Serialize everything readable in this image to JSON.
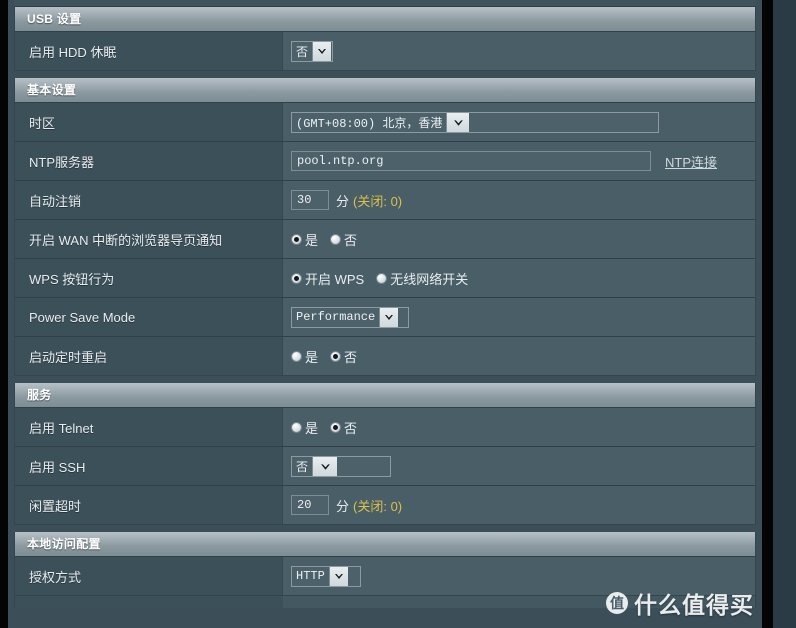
{
  "sections": [
    {
      "id": "usb",
      "title": "USB 设置",
      "rows": [
        {
          "label": "启用 HDD 休眠",
          "control": "select",
          "value": "否"
        }
      ]
    },
    {
      "id": "basic",
      "title": "基本设置",
      "rows": [
        {
          "label": "时区",
          "control": "select",
          "value": "(GMT+08:00) 北京，香港"
        },
        {
          "label": "NTP服务器",
          "control": "text-with-link",
          "value": "pool.ntp.org",
          "link": "NTP连接"
        },
        {
          "label": "自动注销",
          "control": "number-with-hint",
          "value": "30",
          "unit": "分",
          "hint": "(关闭: 0)"
        },
        {
          "label": "开启 WAN 中断的浏览器导页通知",
          "control": "radio",
          "options": [
            {
              "label": "是",
              "checked": true
            },
            {
              "label": "否",
              "checked": false
            }
          ]
        },
        {
          "label": "WPS 按钮行为",
          "control": "radio",
          "options": [
            {
              "label": "开启 WPS",
              "checked": true
            },
            {
              "label": "无线网络开关",
              "checked": false
            }
          ]
        },
        {
          "label": "Power Save Mode",
          "control": "select",
          "value": "Performance"
        },
        {
          "label": "启动定时重启",
          "control": "radio",
          "options": [
            {
              "label": "是",
              "checked": false
            },
            {
              "label": "否",
              "checked": true
            }
          ]
        }
      ]
    },
    {
      "id": "services",
      "title": "服务",
      "rows": [
        {
          "label": "启用 Telnet",
          "control": "radio",
          "options": [
            {
              "label": "是",
              "checked": false
            },
            {
              "label": "否",
              "checked": true
            }
          ]
        },
        {
          "label": "启用 SSH",
          "control": "select",
          "value": "否"
        },
        {
          "label": "闲置超时",
          "control": "number-with-hint",
          "value": "20",
          "unit": "分",
          "hint": "(关闭: 0)"
        }
      ]
    },
    {
      "id": "local-access",
      "title": "本地访问配置",
      "rows": [
        {
          "label": "授权方式",
          "control": "select",
          "value": "HTTP"
        }
      ]
    }
  ],
  "watermark": {
    "logo": "值",
    "text": "什么值得买"
  },
  "colors": {
    "page_background": "#2b3b45",
    "panel_background": "#3f535d",
    "label_column": "#3c5059",
    "value_column": "#4a5e67",
    "section_header_light": "#b7c0c6",
    "hint_yellow": "#d9c14a",
    "text": "#e7ecef"
  }
}
